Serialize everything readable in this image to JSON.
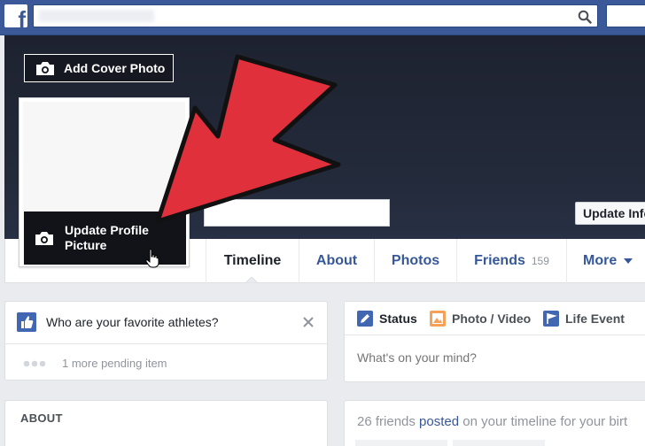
{
  "topbar": {
    "logo_letter": "f",
    "search_value": "",
    "search_icon": "search-icon"
  },
  "cover": {
    "add_cover_label": "Add Cover Photo",
    "update_info_label": "Update Info"
  },
  "profile": {
    "update_picture_label": "Update Profile Picture"
  },
  "tabs": {
    "timeline": "Timeline",
    "about": "About",
    "photos": "Photos",
    "friends": "Friends",
    "friends_count": "159",
    "more": "More"
  },
  "question_card": {
    "question": "Who are your favorite athletes?",
    "pending": "1 more pending item"
  },
  "about_card": {
    "title": "ABOUT"
  },
  "composer": {
    "status_label": "Status",
    "photo_video_label": "Photo / Video",
    "life_event_label": "Life Event",
    "placeholder": "What's on your mind?"
  },
  "friends_posted": {
    "prefix": "26 friends ",
    "link": "posted",
    "suffix": " on your timeline for your birt"
  },
  "colors": {
    "brand": "#3b5998",
    "link": "#365899",
    "arrow": "#e0303c"
  }
}
